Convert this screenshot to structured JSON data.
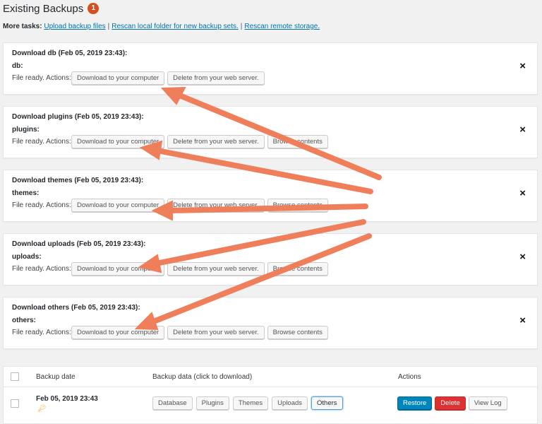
{
  "header": {
    "title": "Existing Backups",
    "badge": "1"
  },
  "tasks": {
    "label": "More tasks:",
    "links": [
      "Upload backup files",
      "Rescan local folder for new backup sets.",
      "Rescan remote storage."
    ],
    "separator": "|"
  },
  "panels": [
    {
      "title": "Download db (Feb 05, 2019 23:43):",
      "name": "db:",
      "status": "File ready. Actions:",
      "download": "Download to your computer",
      "delete": "Delete from your web server.",
      "browse": "",
      "close": "×"
    },
    {
      "title": "Download plugins (Feb 05, 2019 23:43):",
      "name": "plugins:",
      "status": "File ready. Actions:",
      "download": "Download to your computer",
      "delete": "Delete from your web server.",
      "browse": "Browse contents",
      "close": "×"
    },
    {
      "title": "Download themes (Feb 05, 2019 23:43):",
      "name": "themes:",
      "status": "File ready. Actions:",
      "download": "Download to your computer",
      "delete": "Delete from your web server.",
      "browse": "Browse contents",
      "close": "×"
    },
    {
      "title": "Download uploads (Feb 05, 2019 23:43):",
      "name": "uploads:",
      "status": "File ready. Actions:",
      "download": "Download to your computer",
      "delete": "Delete from your web server.",
      "browse": "Browse contents",
      "close": "×"
    },
    {
      "title": "Download others (Feb 05, 2019 23:43):",
      "name": "others:",
      "status": "File ready. Actions:",
      "download": "Download to your computer",
      "delete": "Delete from your web server.",
      "browse": "Browse contents",
      "close": "×"
    }
  ],
  "table": {
    "headers": {
      "date": "Backup date",
      "data": "Backup data (click to download)",
      "actions": "Actions"
    },
    "row": {
      "date": "Feb 05, 2019 23:43",
      "key_icon": "key-icon",
      "data_buttons": [
        "Database",
        "Plugins",
        "Themes",
        "Uploads",
        "Others"
      ],
      "selected": "Others",
      "restore": "Restore",
      "delete": "Delete",
      "view_log": "View Log"
    }
  },
  "colors": {
    "arrow": "#ef7f5a",
    "primary": "#0085ba",
    "danger": "#dc3232",
    "badge": "#d54e21",
    "link": "#0073aa"
  }
}
